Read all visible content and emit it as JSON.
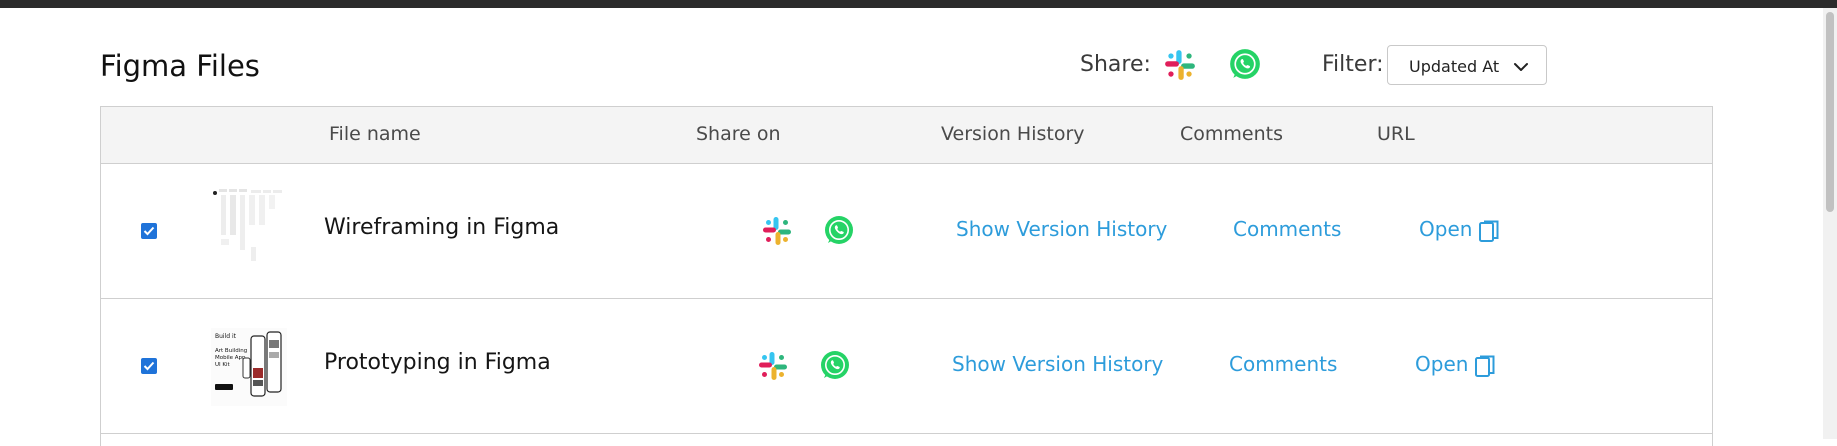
{
  "page": {
    "title": "Figma Files"
  },
  "share": {
    "label": "Share:",
    "icons": [
      "slack-icon",
      "whatsapp-icon"
    ]
  },
  "filter": {
    "label": "Filter:",
    "value": "Updated At"
  },
  "table": {
    "columns": [
      "File name",
      "Share on",
      "Version History",
      "Comments",
      "URL"
    ],
    "rows": [
      {
        "checked": true,
        "file_name": "Wireframing in Figma",
        "version_history": "Show Version History",
        "comments": "Comments",
        "url": "Open"
      },
      {
        "checked": true,
        "file_name": "Prototyping in Figma",
        "version_history": "Show Version History",
        "comments": "Comments",
        "url": "Open"
      }
    ]
  },
  "thumbnail2": {
    "text_lines": [
      "Build it",
      "Art Building",
      "Mobile App",
      "UI Kit"
    ]
  },
  "colors": {
    "link": "#2d9cdb",
    "checkbox": "#1f73d9",
    "whatsapp": "#25d366"
  }
}
